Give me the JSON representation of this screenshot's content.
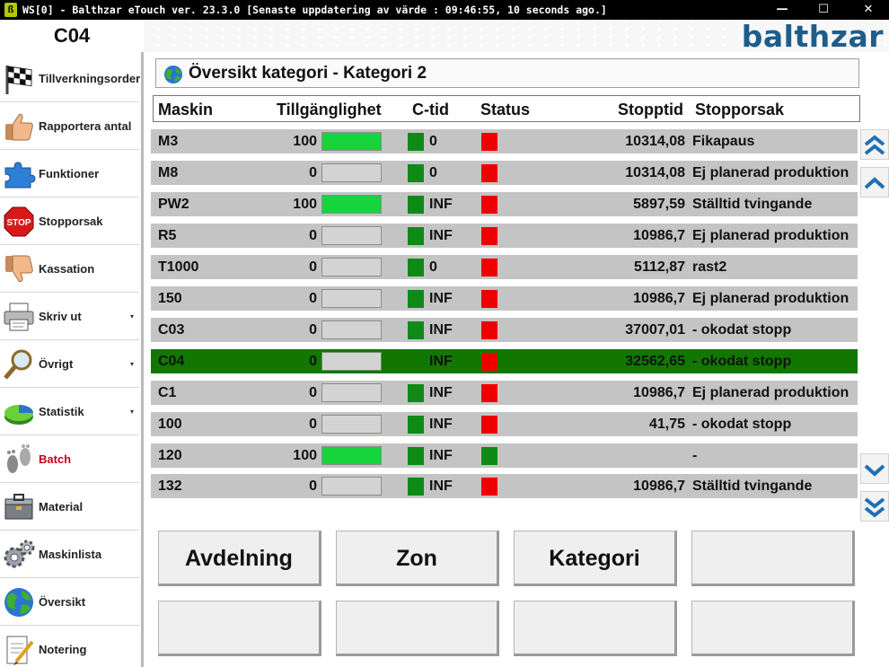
{
  "window": {
    "title": "WS[0] - Balthzar eTouch ver. 23.3.0  [Senaste uppdatering av värde : 09:46:55, 10 seconds ago.]",
    "minimize": "—",
    "maximize": "☐",
    "close": "✕"
  },
  "header": {
    "machine": "C04",
    "brand": "balthzar"
  },
  "sidebar": {
    "items": [
      {
        "label": "Tillverkningsorder",
        "icon": "checkered-flag-icon"
      },
      {
        "label": "Rapportera antal",
        "icon": "thumbs-up-icon"
      },
      {
        "label": "Funktioner",
        "icon": "puzzle-icon"
      },
      {
        "label": "Stopporsak",
        "icon": "stop-sign-icon",
        "icon_text": "STOP"
      },
      {
        "label": "Kassation",
        "icon": "thumbs-down-icon"
      },
      {
        "label": "Skriv ut",
        "icon": "printer-icon",
        "dropdown": "▾"
      },
      {
        "label": "Övrigt",
        "icon": "magnifier-icon",
        "dropdown": "▾"
      },
      {
        "label": "Statistik",
        "icon": "pie-chart-icon",
        "dropdown": "▾"
      },
      {
        "label": "Batch",
        "icon": "footprints-icon"
      },
      {
        "label": "Material",
        "icon": "toolbox-icon"
      },
      {
        "label": "Maskinlista",
        "icon": "gears-icon"
      },
      {
        "label": "Översikt",
        "icon": "globe-icon"
      },
      {
        "label": "Notering",
        "icon": "notepad-icon"
      }
    ]
  },
  "overview": {
    "title": "Översikt kategori - Kategori 2",
    "columns": [
      "Maskin",
      "Tillgänglighet",
      "C-tid",
      "Status",
      "Stopptid",
      "Stopporsak"
    ],
    "rows": [
      {
        "maskin": "M3",
        "tillganglighet": "100",
        "avail_fraction": 1.0,
        "ctid": "0",
        "ct_indicator": true,
        "status_color": "#ee0000",
        "stopptid": "10314,08",
        "stopporsak": "Fikapaus"
      },
      {
        "maskin": "M8",
        "tillganglighet": "0",
        "avail_fraction": 0.0,
        "ctid": "0",
        "ct_indicator": true,
        "status_color": "#ee0000",
        "stopptid": "10314,08",
        "stopporsak": "Ej planerad produktion"
      },
      {
        "maskin": "PW2",
        "tillganglighet": "100",
        "avail_fraction": 1.0,
        "ctid": "INF",
        "ct_indicator": true,
        "status_color": "#ee0000",
        "stopptid": "5897,59",
        "stopporsak": "Ställtid tvingande"
      },
      {
        "maskin": "R5",
        "tillganglighet": "0",
        "avail_fraction": 0.0,
        "ctid": "INF",
        "ct_indicator": true,
        "status_color": "#ee0000",
        "stopptid": "10986,7",
        "stopporsak": "Ej planerad produktion"
      },
      {
        "maskin": "T1000",
        "tillganglighet": "0",
        "avail_fraction": 0.0,
        "ctid": "0",
        "ct_indicator": true,
        "status_color": "#ee0000",
        "stopptid": "5112,87",
        "stopporsak": "rast2"
      },
      {
        "maskin": "150",
        "tillganglighet": "0",
        "avail_fraction": 0.0,
        "ctid": "INF",
        "ct_indicator": true,
        "status_color": "#ee0000",
        "stopptid": "10986,7",
        "stopporsak": "Ej planerad produktion"
      },
      {
        "maskin": "C03",
        "tillganglighet": "0",
        "avail_fraction": 0.0,
        "ctid": "INF",
        "ct_indicator": true,
        "status_color": "#ee0000",
        "stopptid": "37007,01",
        "stopporsak": "- okodat stopp"
      },
      {
        "maskin": "C04",
        "tillganglighet": "0",
        "avail_fraction": 0.0,
        "ctid": "INF",
        "ct_indicator": false,
        "status_color": "#ee0000",
        "stopptid": "32562,65",
        "stopporsak": "- okodat stopp",
        "selected": true
      },
      {
        "maskin": "C1",
        "tillganglighet": "0",
        "avail_fraction": 0.0,
        "ctid": "INF",
        "ct_indicator": true,
        "status_color": "#ee0000",
        "stopptid": "10986,7",
        "stopporsak": "Ej planerad produktion"
      },
      {
        "maskin": "100",
        "tillganglighet": "0",
        "avail_fraction": 0.0,
        "ctid": "INF",
        "ct_indicator": true,
        "status_color": "#ee0000",
        "stopptid": "41,75",
        "stopporsak": "- okodat stopp"
      },
      {
        "maskin": "120",
        "tillganglighet": "100",
        "avail_fraction": 1.0,
        "ctid": "INF",
        "ct_indicator": true,
        "status_color": "#0f8a17",
        "stopptid": "",
        "stopporsak": "-"
      },
      {
        "maskin": "132",
        "tillganglighet": "0",
        "avail_fraction": 0.0,
        "ctid": "INF",
        "ct_indicator": true,
        "status_color": "#ee0000",
        "stopptid": "10986,7",
        "stopporsak": "Ställtid tvingande"
      }
    ]
  },
  "scroll": {
    "top": "double-chevron-up-icon",
    "up": "chevron-up-icon",
    "down": "chevron-down-icon",
    "bottom": "double-chevron-down-icon"
  },
  "buttons": {
    "row1": [
      "Avdelning",
      "Zon",
      "Kategori",
      ""
    ],
    "row2": [
      "",
      "",
      "",
      ""
    ]
  },
  "colors": {
    "selected_row": "#117700",
    "availability_fill": "#16d43b",
    "ct_green": "#0f8a17",
    "status_red": "#ee0000",
    "brand": "#1d5d8a"
  }
}
